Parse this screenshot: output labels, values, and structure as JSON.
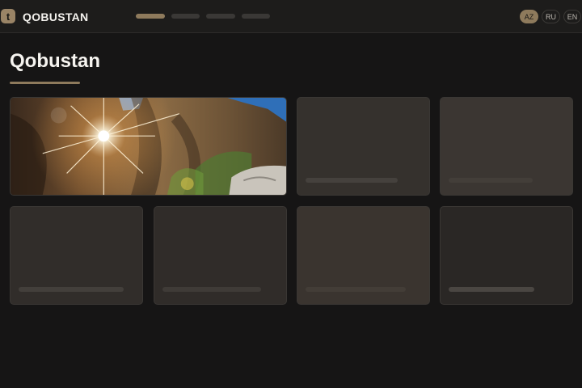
{
  "header": {
    "logo_letter": "t",
    "brand": "QOBUSTAN",
    "nav": [
      {
        "name": "nav-item-1",
        "active": true
      },
      {
        "name": "nav-item-2",
        "active": false
      },
      {
        "name": "nav-item-3",
        "active": false
      },
      {
        "name": "nav-item-4",
        "active": false
      }
    ],
    "languages": [
      {
        "code": "AZ",
        "active": true
      },
      {
        "code": "RU",
        "active": false
      },
      {
        "code": "EN",
        "active": false
      }
    ]
  },
  "main": {
    "title": "Qobustan",
    "gallery": [
      {
        "type": "photo",
        "alt": "sunburst-over-rock"
      },
      {
        "type": "placeholder"
      },
      {
        "type": "placeholder"
      },
      {
        "type": "placeholder"
      },
      {
        "type": "placeholder"
      },
      {
        "type": "placeholder"
      },
      {
        "type": "placeholder"
      }
    ]
  },
  "colors": {
    "accent": "#8e7a5c",
    "background": "#161515",
    "header": "#1d1c1b"
  }
}
